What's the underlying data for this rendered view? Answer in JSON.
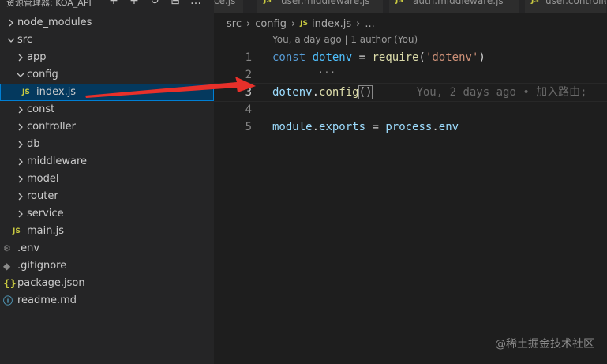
{
  "sidebar": {
    "title": "资源管理器: KOA_API",
    "actions": [
      {
        "name": "new-file-icon",
        "glyph": "+"
      },
      {
        "name": "new-folder-icon",
        "glyph": "+"
      },
      {
        "name": "refresh-icon",
        "glyph": "↻"
      },
      {
        "name": "collapse-all-icon",
        "glyph": "⊟"
      },
      {
        "name": "more-icon",
        "glyph": "…"
      }
    ],
    "tree": [
      {
        "label": "node_modules",
        "type": "folder",
        "expanded": false,
        "depth": 0
      },
      {
        "label": "src",
        "type": "folder",
        "expanded": true,
        "depth": 0
      },
      {
        "label": "app",
        "type": "folder",
        "expanded": false,
        "depth": 1
      },
      {
        "label": "config",
        "type": "folder",
        "expanded": true,
        "depth": 1
      },
      {
        "label": "index.js",
        "type": "js",
        "depth": 2,
        "selected": true,
        "icon_text": "JS"
      },
      {
        "label": "const",
        "type": "folder",
        "expanded": false,
        "depth": 1
      },
      {
        "label": "controller",
        "type": "folder",
        "expanded": false,
        "depth": 1
      },
      {
        "label": "db",
        "type": "folder",
        "expanded": false,
        "depth": 1
      },
      {
        "label": "middleware",
        "type": "folder",
        "expanded": false,
        "depth": 1
      },
      {
        "label": "model",
        "type": "folder",
        "expanded": false,
        "depth": 1
      },
      {
        "label": "router",
        "type": "folder",
        "expanded": false,
        "depth": 1
      },
      {
        "label": "service",
        "type": "folder",
        "expanded": false,
        "depth": 1
      },
      {
        "label": "main.js",
        "type": "js",
        "depth": 1,
        "icon_text": "JS"
      },
      {
        "label": ".env",
        "type": "env",
        "depth": 0
      },
      {
        "label": ".gitignore",
        "type": "git",
        "depth": 0
      },
      {
        "label": "package.json",
        "type": "json",
        "depth": 0,
        "icon_text": "{}"
      },
      {
        "label": "readme.md",
        "type": "info",
        "depth": 0
      }
    ]
  },
  "tabs": [
    {
      "label": "ce.js",
      "icon_text": ""
    },
    {
      "label": "user.middleware.js",
      "icon_text": "JS"
    },
    {
      "label": "auth.middleware.js",
      "icon_text": "JS"
    },
    {
      "label": "user.controlle",
      "icon_text": "JS"
    }
  ],
  "breadcrumb": {
    "parts": [
      "src",
      "config"
    ],
    "file_icon": "JS",
    "file": "index.js",
    "tail": "..."
  },
  "codelens": "You, a day ago | 1 author (You)",
  "code_lines": [
    {
      "n": "1"
    },
    {
      "n": "2"
    },
    {
      "n": "3"
    },
    {
      "n": "4"
    },
    {
      "n": "5"
    }
  ],
  "code": {
    "l1": {
      "kw": "const",
      "var": "dotenv",
      "op": "=",
      "fn": "require",
      "p1": "(",
      "str": "'dotenv'",
      "p2": ")"
    },
    "l3": {
      "obj": "dotenv",
      "dot": ".",
      "fn": "config",
      "parens": "()",
      "blame": "You, 2 days ago • 加入路由;"
    },
    "l5": {
      "mod": "module",
      "dot1": ".",
      "exp": "exports",
      "op": "=",
      "proc": "process",
      "dot2": ".",
      "env": "env"
    }
  },
  "squiggle": "...",
  "watermark": "@稀土掘金技术社区",
  "colors": {
    "arrow": "#e8302a",
    "selection": "#04395e",
    "accent": "#007fd4"
  }
}
